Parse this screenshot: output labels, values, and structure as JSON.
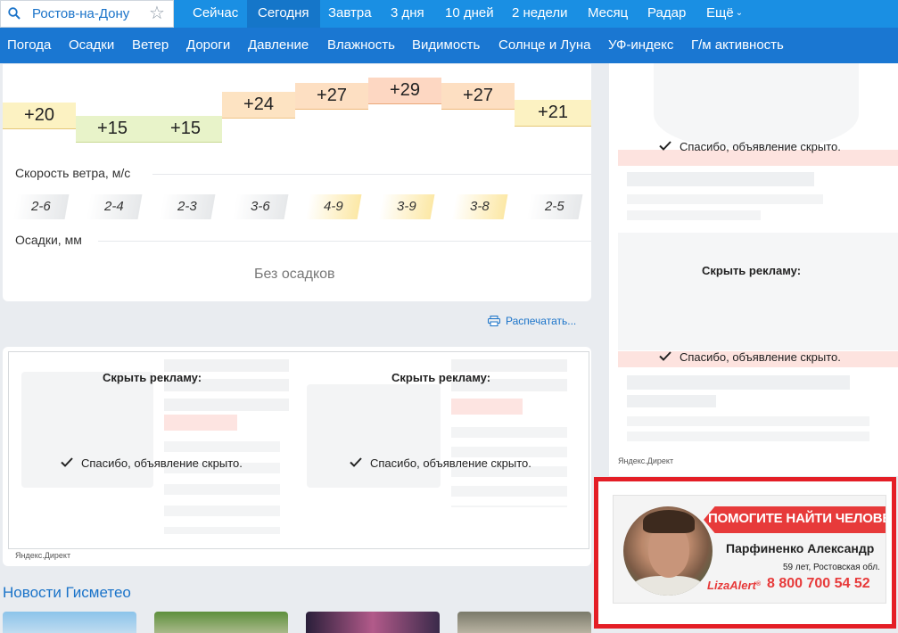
{
  "search": {
    "city": "Ростов-на-Дону",
    "icon": "search-icon",
    "favorite_icon": "star-icon"
  },
  "tabs": [
    {
      "label": "Сейчас"
    },
    {
      "label": "Сегодня",
      "active": true
    },
    {
      "label": "Завтра"
    },
    {
      "label": "3 дня"
    },
    {
      "label": "10 дней"
    },
    {
      "label": "2 недели"
    },
    {
      "label": "Месяц"
    },
    {
      "label": "Радар"
    },
    {
      "label": "Ещё",
      "icon": "chevron-down-icon"
    }
  ],
  "subnav": [
    "Погода",
    "Осадки",
    "Ветер",
    "Дороги",
    "Давление",
    "Влажность",
    "Видимость",
    "Солнце и Луна",
    "УФ-индекс",
    "Г/м активность"
  ],
  "forecast": {
    "temps": [
      "+20",
      "+15",
      "+15",
      "+24",
      "+27",
      "+29",
      "+27",
      "+21"
    ],
    "wind_label": "Скорость ветра, м/с",
    "wind": [
      {
        "value": "2-6",
        "level": "grey"
      },
      {
        "value": "2-4",
        "level": "grey"
      },
      {
        "value": "2-3",
        "level": "grey"
      },
      {
        "value": "3-6",
        "level": "grey"
      },
      {
        "value": "4-9",
        "level": "yellow"
      },
      {
        "value": "3-9",
        "level": "yellow"
      },
      {
        "value": "3-8",
        "level": "yellow"
      },
      {
        "value": "2-5",
        "level": "grey"
      }
    ],
    "precip_label": "Осадки, мм",
    "precip_value": "Без осадков"
  },
  "print_label": "Распечатать...",
  "ads": {
    "hide_title": "Скрыть рекламу:",
    "hidden_message": "Спасибо, объявление скрыто.",
    "yandex_direct": "Яндекс.Директ"
  },
  "news": {
    "title": "Новости Гисметео"
  },
  "banner": {
    "headline": "ПОМОГИТЕ НАЙТИ ЧЕЛОВЕКА",
    "name": "Парфиненко Александр",
    "info": "59 лет, Ростовская обл.",
    "brand": "LizaAlert",
    "brand_mark": "®",
    "phone": "8 800 700 54 52"
  },
  "colors": {
    "nav": "#1a8fe3",
    "subnav": "#1a77d2",
    "active_tab": "#1576c9",
    "highlight_frame": "#e41e26",
    "alert_red": "#e73a3a"
  }
}
